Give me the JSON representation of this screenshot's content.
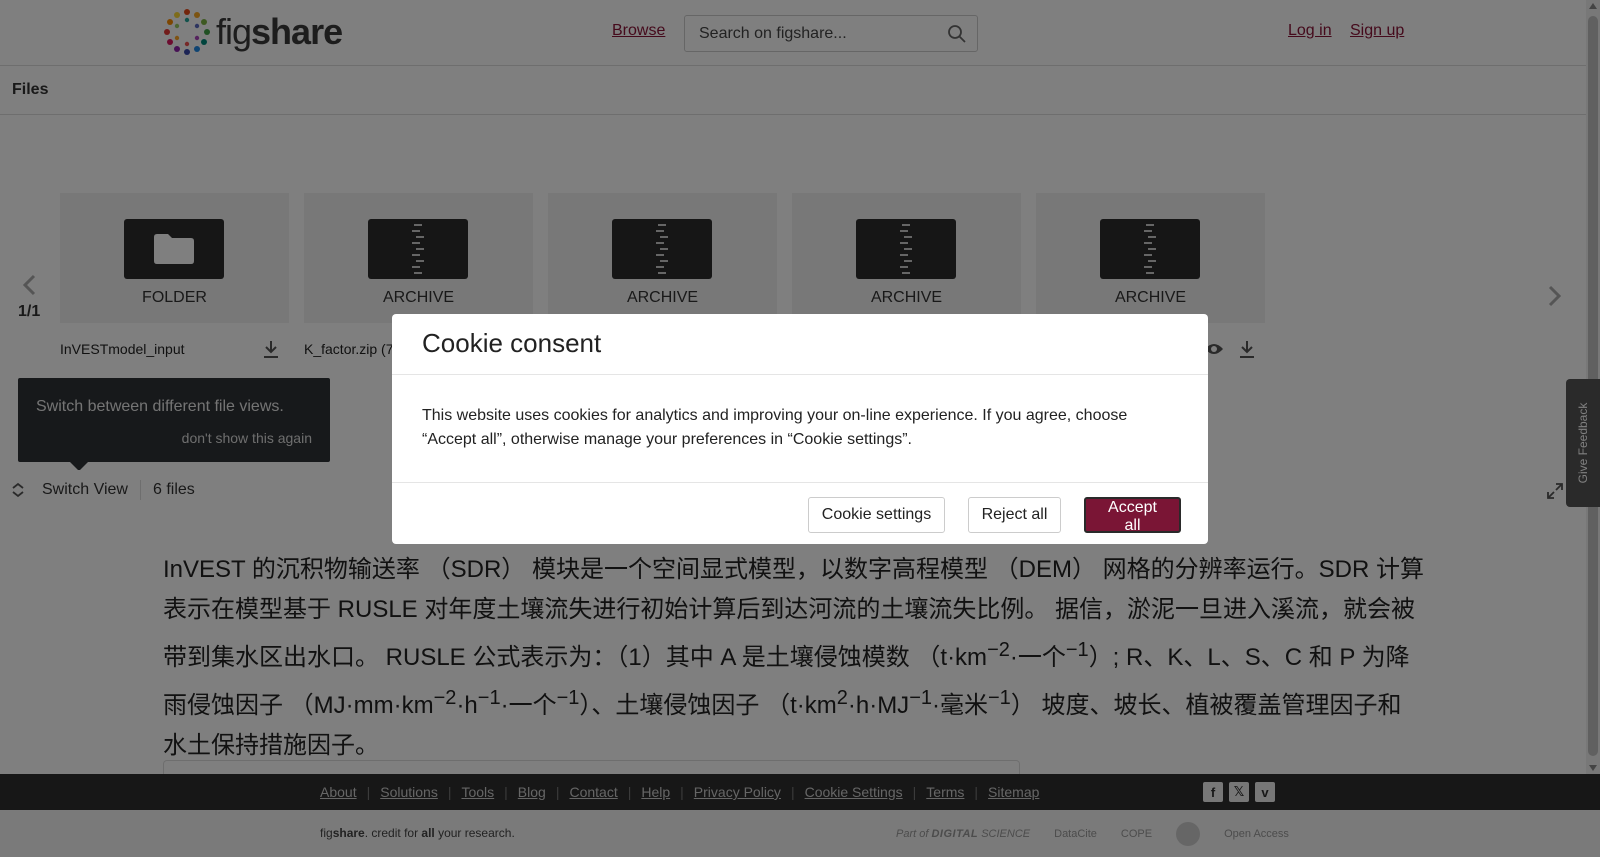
{
  "header": {
    "logo": "figshare",
    "logo_bold": "share",
    "logo_thin": "fig",
    "browse": "Browse",
    "search_placeholder": "Search on figshare...",
    "login": "Log in",
    "signup": "Sign up"
  },
  "files_bar": {
    "title": "Files"
  },
  "viewer": {
    "page_count": "1/1",
    "tiles": [
      {
        "kind": "FOLDER",
        "name": "InVESTmodel_input",
        "icon": "folder-icon"
      },
      {
        "kind": "ARCHIVE",
        "name": "K_factor.zip (7",
        "icon": "zip-icon"
      },
      {
        "kind": "ARCHIVE",
        "name": "",
        "icon": "zip-icon"
      },
      {
        "kind": "ARCHIVE",
        "name": "",
        "icon": "zip-icon"
      },
      {
        "kind": "ARCHIVE",
        "name": "",
        "icon": "zip-icon"
      }
    ],
    "tooltip": {
      "message": "Switch between different file views.",
      "dismiss": "don't show this again"
    },
    "toolbar": {
      "switch_view": "Switch View",
      "files_count": "6 files"
    }
  },
  "description": {
    "part1": "InVEST 的沉积物输送率 （SDR） 模块是一个空间显式模型，以数字高程模型 （DEM） 网格的分辨率运行。SDR 计算表示在模型基于 RUSLE 对年度土壤流失进行初始计算后到达河流的土壤流失比例。 据信，淤泥一旦进入溪流，就会被带到集水区出水口。 RUSLE 公式表示为：（1）其中 A 是土壤侵蚀模数 （t·km",
    "sup1": "−2",
    "part2": "·一个",
    "sup2": "−1",
    "part3": "）; R、K、L、S、C 和 P 为降雨侵蚀因子 （MJ·mm·km",
    "sup3": "−2",
    "part4": "·h",
    "sup4": "−1",
    "part5": "·一个",
    "sup5": "−1",
    "part6": "）、土壤侵蚀因子 （t·km",
    "sup6": "2",
    "part7": "·h·MJ",
    "sup7": "−1",
    "part8": "·毫米",
    "sup8": "−1",
    "part9": "） 坡度、坡长、植被覆盖管理因子和水土保持措施因子。"
  },
  "feedback": "Give Feedback",
  "footer": {
    "links": [
      "About",
      "Solutions",
      "Tools",
      "Blog",
      "Contact",
      "Help",
      "Privacy Policy",
      "Cookie Settings",
      "Terms",
      "Sitemap"
    ],
    "social": [
      {
        "icon": "facebook-icon",
        "glyph": "f"
      },
      {
        "icon": "x-icon",
        "glyph": "𝕏"
      },
      {
        "icon": "vimeo-icon",
        "glyph": "v"
      }
    ],
    "tagline_pre": "fig",
    "tagline_bold": "share",
    "tagline_mid": ". credit for ",
    "tagline_all": "all",
    "tagline_post": " your research.",
    "partners": {
      "ds_pre": "Part of",
      "ds_name": "DIGITAL",
      "ds_post": "SCIENCE",
      "datacite": "DataCite",
      "cope": "COPE",
      "open_access": "Open Access"
    }
  },
  "cookie_modal": {
    "title": "Cookie consent",
    "body": "This website uses cookies for analytics and improving your on-line experience. If you agree, choose “Accept all”, otherwise manage your preferences in “Cookie settings”.",
    "settings": "Cookie settings",
    "reject": "Reject all",
    "accept": "Accept all"
  },
  "colors": {
    "brand": "#8a1538",
    "accept_button": "#7a1535",
    "footer_dark": "#2f2f2f"
  }
}
